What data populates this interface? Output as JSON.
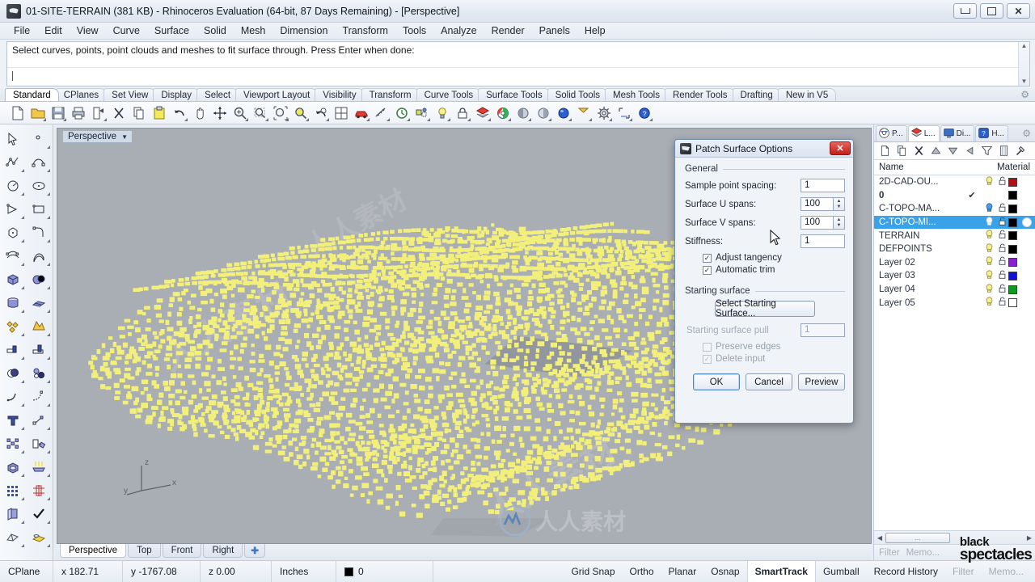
{
  "window": {
    "title": "01-SITE-TERRAIN (381 KB) - Rhinoceros Evaluation (64-bit, 87 Days Remaining) - [Perspective]",
    "app_icon": "rhino-icon",
    "minimize": "minimize-icon",
    "maximize": "maximize-icon",
    "close": "close-icon"
  },
  "menubar": {
    "items": [
      "File",
      "Edit",
      "View",
      "Curve",
      "Surface",
      "Solid",
      "Mesh",
      "Dimension",
      "Transform",
      "Tools",
      "Analyze",
      "Render",
      "Panels",
      "Help"
    ]
  },
  "command": {
    "history": "Select curves, points, point clouds and meshes to fit surface through. Press Enter when done:",
    "input_value": "",
    "scroll_up": "scroll-up-icon",
    "scroll_down": "scroll-down-icon"
  },
  "toolbar_tabs": {
    "items": [
      "Standard",
      "CPlanes",
      "Set View",
      "Display",
      "Select",
      "Viewport Layout",
      "Visibility",
      "Transform",
      "Curve Tools",
      "Surface Tools",
      "Solid Tools",
      "Mesh Tools",
      "Render Tools",
      "Drafting",
      "New in V5"
    ],
    "active": "Standard",
    "options_icon": "gear-icon"
  },
  "standard_toolbar": {
    "icons": [
      "new-file-icon",
      "open-folder-icon",
      "save-icon",
      "print-icon",
      "export-icon",
      "delete-x-icon",
      "copy-icon",
      "paste-icon",
      "undo-icon",
      "pan-icon",
      "move-icon",
      "zoom-in-icon",
      "zoom-window-icon",
      "zoom-extents-icon",
      "zoom-selected-icon",
      "zoom-previous-icon",
      "viewport-layout-icon",
      "render-car-icon",
      "measure-icon",
      "history-icon",
      "properties-icon",
      "light-bulb-icon",
      "lock-icon",
      "layers-icon",
      "color-wheel-icon",
      "shade-icon",
      "render-preview-icon",
      "render-sphere-icon",
      "flag-icon",
      "options-gear-icon",
      "cplane-icon",
      "help-icon"
    ]
  },
  "left_toolbar": {
    "icons": [
      "select-arrow-icon",
      "point-icon",
      "polyline-icon",
      "control-point-curve-icon",
      "circle-icon",
      "ellipse-icon",
      "arc-icon",
      "rectangle-icon",
      "polygon-icon",
      "curve-fillet-icon",
      "surface-from-points-icon",
      "extrude-surface-icon",
      "box-icon",
      "sphere-icon",
      "cylinder-icon",
      "surface-patch-icon",
      "explode-icon",
      "join-icon",
      "trim-icon",
      "split-icon",
      "boolean-union-icon",
      "boolean-difference-icon",
      "fillet-edge-icon",
      "blend-curve-icon",
      "text-icon",
      "dimension-icon",
      "array-icon",
      "transform-box-icon",
      "solid-tools-icon",
      "render-lights-icon",
      "grid-icon",
      "analyze-icon",
      "layout-icon",
      "check-icon",
      "mesh-icon",
      "render-material-icon"
    ]
  },
  "viewport": {
    "label": "Perspective",
    "dropdown_icon": "chevron-down-icon",
    "background_color": "#a9adb4",
    "point_color": "#f2f07a",
    "axis": {
      "x": "x",
      "y": "y",
      "z": "z"
    },
    "watermark": "人人素材",
    "tabs": [
      "Perspective",
      "Top",
      "Front",
      "Right"
    ],
    "active_tab": "Perspective",
    "add_tab_icon": "plus-icon"
  },
  "panel": {
    "tabs": [
      {
        "label": "P...",
        "icon": "properties-icon",
        "active": false
      },
      {
        "label": "L...",
        "icon": "layers-icon",
        "active": true
      },
      {
        "label": "Di...",
        "icon": "display-icon",
        "active": false
      },
      {
        "label": "H...",
        "icon": "help-icon",
        "active": false
      }
    ],
    "gear_icon": "gear-icon",
    "tools": [
      "new-layer-icon",
      "copy-layer-icon",
      "delete-layer-icon",
      "move-up-icon",
      "move-down-icon",
      "back-arrow-icon",
      "filter-icon",
      "properties-panel-icon",
      "tools-hammer-icon"
    ],
    "columns": {
      "name": "Name",
      "material": "Material"
    },
    "layers": [
      {
        "name": "2D-CAD-OU...",
        "current": false,
        "on": true,
        "locked": false,
        "color": "#b01010",
        "selected": false,
        "material": false,
        "bulb": "yellow"
      },
      {
        "name": "0",
        "current": true,
        "on": false,
        "locked": false,
        "color": "#000000",
        "selected": false,
        "material": false,
        "bulb": "none"
      },
      {
        "name": "C-TOPO-MA...",
        "current": false,
        "on": true,
        "locked": false,
        "color": "#000000",
        "selected": false,
        "material": false,
        "bulb": "blue"
      },
      {
        "name": "C-TOPO-MI...",
        "current": false,
        "on": true,
        "locked": false,
        "color": "#000000",
        "selected": true,
        "material": true,
        "bulb": "white"
      },
      {
        "name": "TERRAIN",
        "current": false,
        "on": true,
        "locked": false,
        "color": "#000000",
        "selected": false,
        "material": false,
        "bulb": "yellow"
      },
      {
        "name": "DEFPOINTS",
        "current": false,
        "on": true,
        "locked": false,
        "color": "#000000",
        "selected": false,
        "material": false,
        "bulb": "yellow"
      },
      {
        "name": "Layer 02",
        "current": false,
        "on": true,
        "locked": false,
        "color": "#8a1fd0",
        "selected": false,
        "material": false,
        "bulb": "yellow"
      },
      {
        "name": "Layer 03",
        "current": false,
        "on": true,
        "locked": false,
        "color": "#1010d8",
        "selected": false,
        "material": false,
        "bulb": "yellow"
      },
      {
        "name": "Layer 04",
        "current": false,
        "on": true,
        "locked": false,
        "color": "#0f9a22",
        "selected": false,
        "material": false,
        "bulb": "yellow"
      },
      {
        "name": "Layer 05",
        "current": false,
        "on": true,
        "locked": false,
        "color": "#ffffff",
        "selected": false,
        "material": false,
        "bulb": "yellow"
      }
    ],
    "footer": {
      "filter": "Filter",
      "memory": "Memo..."
    },
    "scroll_left_icon": "scroll-left-icon",
    "scroll_right_icon": "scroll-right-icon",
    "scroll_thumb": "..."
  },
  "dialog": {
    "title": "Patch Surface Options",
    "icon": "rhino-icon",
    "close_icon": "close-icon",
    "general_group": "General",
    "fields": {
      "sample_point_spacing_label": "Sample point spacing:",
      "sample_point_spacing_value": "1",
      "surface_u_spans_label": "Surface U spans:",
      "surface_u_spans_value": "100",
      "surface_v_spans_label": "Surface V spans:",
      "surface_v_spans_value": "100",
      "stiffness_label": "Stiffness:",
      "stiffness_value": "1"
    },
    "checkboxes": {
      "adjust_tangency_label": "Adjust tangency",
      "adjust_tangency_checked": true,
      "automatic_trim_label": "Automatic trim",
      "automatic_trim_checked": true,
      "preserve_edges_label": "Preserve edges",
      "preserve_edges_checked": false,
      "delete_input_label": "Delete input",
      "delete_input_checked": true
    },
    "starting_surface_group": "Starting surface",
    "select_starting_surface_button": "Select Starting Surface...",
    "starting_surface_pull_label": "Starting surface pull",
    "starting_surface_pull_value": "1",
    "buttons": {
      "ok": "OK",
      "cancel": "Cancel",
      "preview": "Preview"
    }
  },
  "statusbar": {
    "cplane": "CPlane",
    "x": "x 182.71",
    "y": "y -1767.08",
    "z": "z 0.00",
    "units": "Inches",
    "layer": "0",
    "layer_color": "#000000",
    "toggles": [
      {
        "label": "Grid Snap",
        "on": false,
        "dim": false
      },
      {
        "label": "Ortho",
        "on": false,
        "dim": false
      },
      {
        "label": "Planar",
        "on": false,
        "dim": false
      },
      {
        "label": "Osnap",
        "on": false,
        "dim": false
      },
      {
        "label": "SmartTrack",
        "on": true,
        "dim": false
      },
      {
        "label": "Gumball",
        "on": false,
        "dim": false
      },
      {
        "label": "Record History",
        "on": false,
        "dim": false
      },
      {
        "label": "Filter",
        "on": false,
        "dim": true
      },
      {
        "label": "Memo...",
        "on": false,
        "dim": true
      }
    ]
  },
  "branding": {
    "line1": "black",
    "line2": "spectacles"
  }
}
